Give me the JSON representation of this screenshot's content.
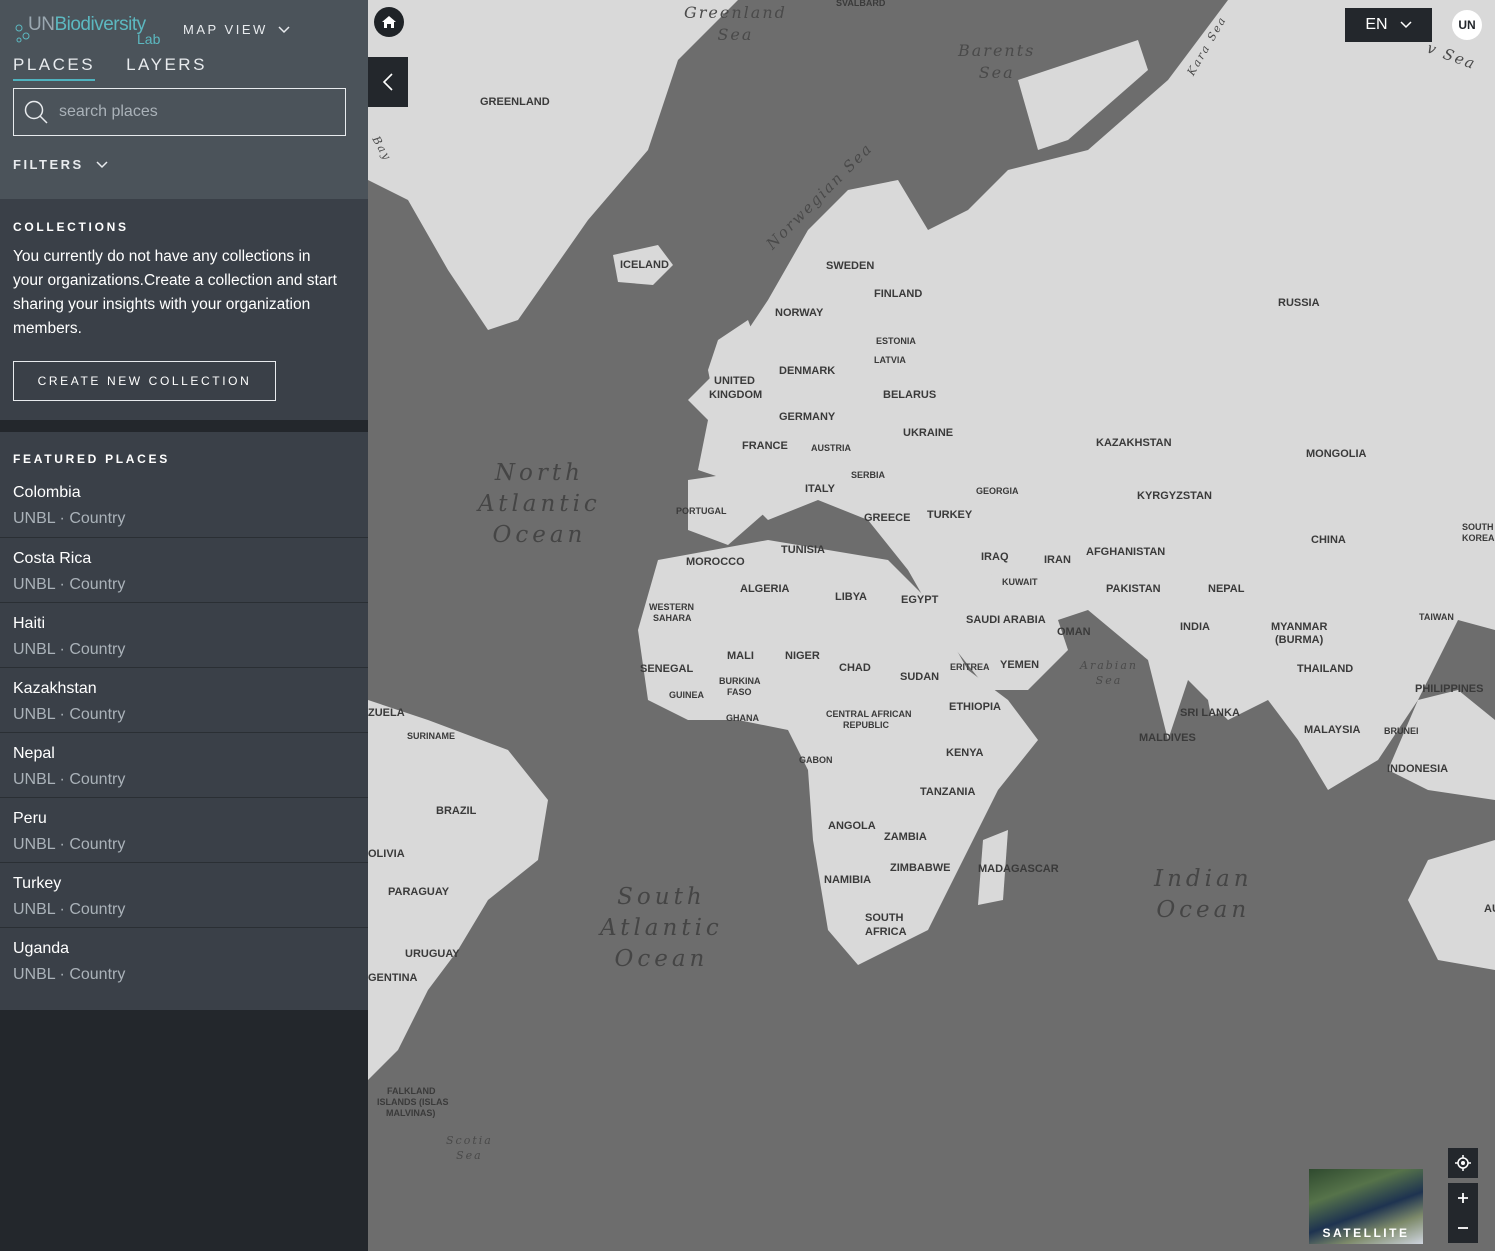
{
  "app": {
    "logo_un": "UN",
    "logo_biodiversity": "Biodiversity",
    "logo_lab": "Lab",
    "map_view_label": "MAP VIEW"
  },
  "tabs": [
    {
      "label": "PLACES",
      "active": true
    },
    {
      "label": "LAYERS",
      "active": false
    }
  ],
  "search": {
    "placeholder": "search places",
    "value": ""
  },
  "filters_label": "FILTERS",
  "collections": {
    "title": "COLLECTIONS",
    "message": "You currently do not have any collections in your organizations.Create a collection and start sharing your insights with your organization members.",
    "create_button": "CREATE NEW COLLECTION"
  },
  "featured": {
    "title": "FEATURED PLACES",
    "places": [
      {
        "name": "Colombia",
        "source": "UNBL",
        "type": "Country"
      },
      {
        "name": "Costa Rica",
        "source": "UNBL",
        "type": "Country"
      },
      {
        "name": "Haiti",
        "source": "UNBL",
        "type": "Country"
      },
      {
        "name": "Kazakhstan",
        "source": "UNBL",
        "type": "Country"
      },
      {
        "name": "Nepal",
        "source": "UNBL",
        "type": "Country"
      },
      {
        "name": "Peru",
        "source": "UNBL",
        "type": "Country"
      },
      {
        "name": "Turkey",
        "source": "UNBL",
        "type": "Country"
      },
      {
        "name": "Uganda",
        "source": "UNBL",
        "type": "Country"
      }
    ]
  },
  "header": {
    "language": "EN",
    "user_initials": "UN"
  },
  "map": {
    "basemap_toggle_label": "SATELLITE",
    "oceans": {
      "north_atlantic": [
        "North",
        "Atlantic",
        "Ocean"
      ],
      "south_atlantic": [
        "South",
        "Atlantic",
        "Ocean"
      ],
      "indian": [
        "Indian",
        "Ocean"
      ]
    },
    "seas": {
      "greenland": [
        "Greenland",
        "Sea"
      ],
      "barents": [
        "Barents",
        "Sea"
      ],
      "norwegian": "Norwegian Sea",
      "arabian": [
        "Arabian",
        "Sea"
      ],
      "scotia": [
        "Scotia",
        "Sea"
      ],
      "kara": "Kara Sea",
      "laptev_partial": "v Sea",
      "svalbard": "SVALBARD",
      "bay_partial": "Bay"
    },
    "countries": {
      "greenland": "GREENLAND",
      "iceland": "ICELAND",
      "sweden": "SWEDEN",
      "finland": "FINLAND",
      "norway": "NORWAY",
      "estonia": "ESTONIA",
      "latvia": "LATVIA",
      "denmark": "DENMARK",
      "uk_1": "UNITED",
      "uk_2": "KINGDOM",
      "belarus": "BELARUS",
      "germany": "GERMANY",
      "ukraine": "UKRAINE",
      "france": "FRANCE",
      "austria": "AUSTRIA",
      "serbia": "SERBIA",
      "italy": "ITALY",
      "georgia": "GEORGIA",
      "portugal": "PORTUGAL",
      "greece": "GREECE",
      "turkey": "TURKEY",
      "tunisia": "TUNISIA",
      "morocco": "MOROCCO",
      "algeria": "ALGERIA",
      "libya": "LIBYA",
      "egypt": "EGYPT",
      "iraq": "IRAQ",
      "iran": "IRAN",
      "kuwait": "KUWAIT",
      "saudi_arabia": "SAUDI ARABIA",
      "oman": "OMAN",
      "yemen": "YEMEN",
      "western_sahara_1": "WESTERN",
      "western_sahara_2": "SAHARA",
      "mali": "MALI",
      "niger": "NIGER",
      "chad": "CHAD",
      "sudan": "SUDAN",
      "eritrea": "ERITREA",
      "senegal": "SENEGAL",
      "burkina_1": "BURKINA",
      "burkina_2": "FASO",
      "guinea": "GUINEA",
      "ghana": "GHANA",
      "ethiopia": "ETHIOPIA",
      "car_1": "CENTRAL AFRICAN",
      "car_2": "REPUBLIC",
      "gabon": "GABON",
      "kenya": "KENYA",
      "tanzania": "TANZANIA",
      "angola": "ANGOLA",
      "zambia": "ZAMBIA",
      "zimbabwe": "ZIMBABWE",
      "namibia": "NAMIBIA",
      "madagascar": "MADAGASCAR",
      "south_africa_1": "SOUTH",
      "south_africa_2": "AFRICA",
      "russia": "RUSSIA",
      "kazakhstan": "KAZAKHSTAN",
      "mongolia": "MONGOLIA",
      "kyrgyzstan": "KYRGYZSTAN",
      "china": "CHINA",
      "south_korea_1": "SOUTH",
      "south_korea_2": "KOREA",
      "afghanistan": "AFGHANISTAN",
      "pakistan": "PAKISTAN",
      "nepal": "NEPAL",
      "india": "INDIA",
      "myanmar_1": "MYANMAR",
      "myanmar_2": "(BURMA)",
      "taiwan": "TAIWAN",
      "thailand": "THAILAND",
      "philippines": "PHILIPPINES",
      "sri_lanka": "SRI LANKA",
      "maldives": "MALDIVES",
      "malaysia": "MALAYSIA",
      "brunei": "BRUNEI",
      "indonesia": "INDONESIA",
      "venezuela_partial": "ZUELA",
      "suriname": "SURINAME",
      "brazil": "BRAZIL",
      "bolivia_partial": "OLIVIA",
      "paraguay": "PARAGUAY",
      "uruguay": "URUGUAY",
      "argentina_partial": "GENTINA",
      "falklands_1": "FALKLAND",
      "falklands_2": "ISLANDS (ISLAS",
      "falklands_3": "MALVINAS)",
      "australia_partial": "AU"
    }
  }
}
